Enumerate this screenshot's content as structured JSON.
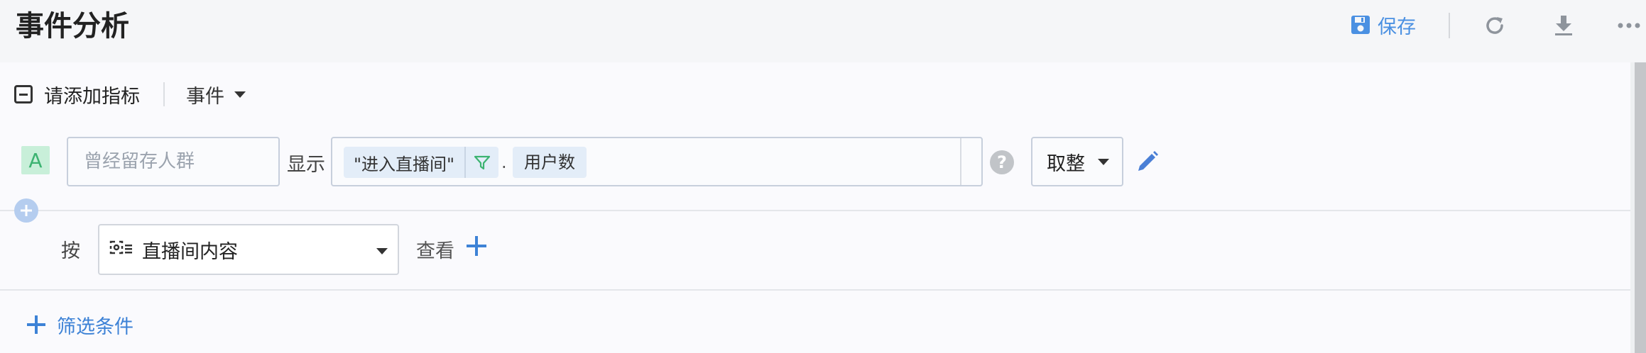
{
  "header": {
    "title": "事件分析",
    "save_label": "保存",
    "icons": [
      "save-icon",
      "refresh-icon",
      "download-icon",
      "more-icon"
    ]
  },
  "metric": {
    "add_metric_label": "请添加指标",
    "type_dropdown": "事件"
  },
  "query": {
    "badge": "A",
    "cohort_placeholder": "曾经留存人群",
    "show_label": "显示",
    "event_chip": "\"进入直播间\"",
    "separator": ".",
    "metric_chip": "用户数",
    "help_glyph": "?",
    "rounding": "取整"
  },
  "group_by": {
    "by_label": "按",
    "dimension": "直播间内容",
    "view_label": "查看"
  },
  "filter": {
    "add_filter_label": "筛选条件"
  },
  "colors": {
    "accent": "#4a90e2",
    "badge_bg": "#c8efd9",
    "badge_text": "#3cb371",
    "chip_bg": "#e3edf8"
  }
}
